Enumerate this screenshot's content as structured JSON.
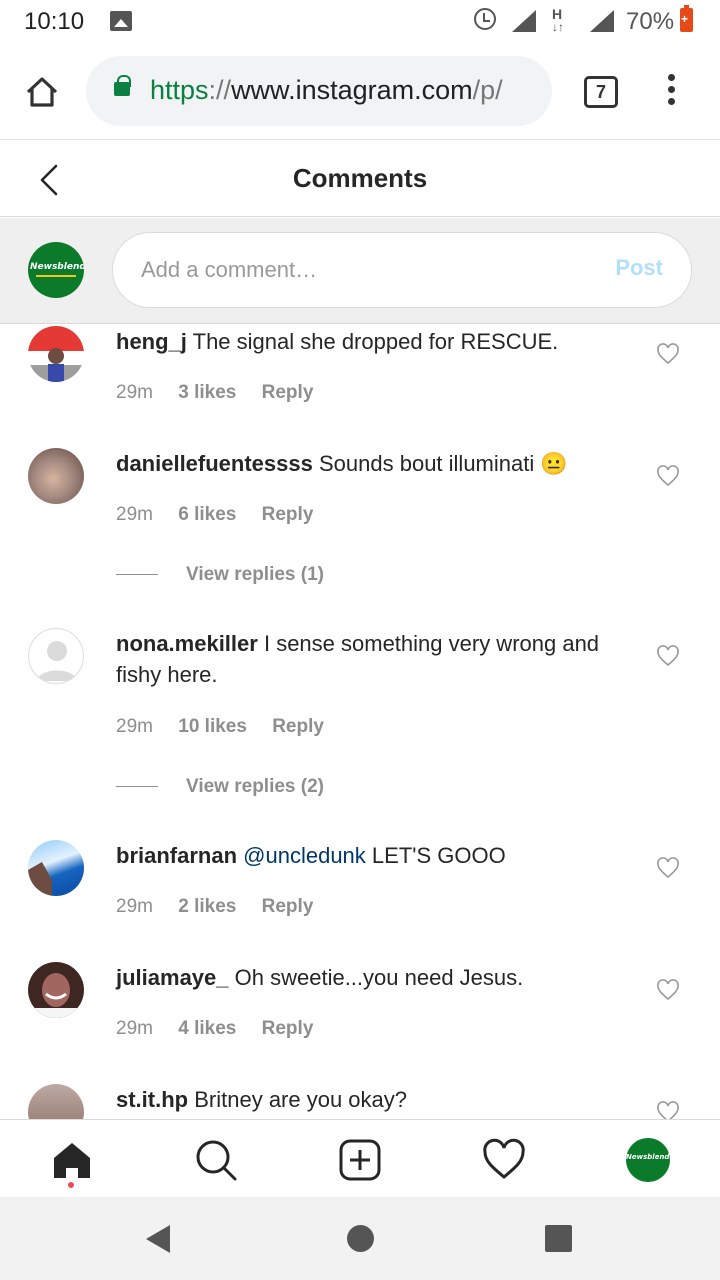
{
  "status_bar": {
    "time": "10:10",
    "network": "H",
    "battery": "70%"
  },
  "browser": {
    "url_scheme": "https",
    "url_sep": "://",
    "url_host": "www.instagram.com",
    "url_path": "/p/",
    "tab_count": "7"
  },
  "header": {
    "title": "Comments"
  },
  "composer": {
    "avatar_text": "Newsblenda",
    "placeholder": "Add a comment…",
    "post_label": "Post"
  },
  "comments": [
    {
      "user": "heng_j",
      "mention": "",
      "text": "The signal she dropped for RESCUE.",
      "time": "29m",
      "likes": "3 likes",
      "reply": "Reply",
      "view_replies": ""
    },
    {
      "user": "daniellefuentessss",
      "mention": "",
      "text": "Sounds bout illuminati 😐",
      "time": "29m",
      "likes": "6 likes",
      "reply": "Reply",
      "view_replies": "View replies (1)"
    },
    {
      "user": "nona.mekiller",
      "mention": "",
      "text": "I sense something very wrong and fishy here.",
      "time": "29m",
      "likes": "10 likes",
      "reply": "Reply",
      "view_replies": "View replies (2)"
    },
    {
      "user": "brianfarnan",
      "mention": "@uncledunk",
      "text": "LET'S GOOO",
      "time": "29m",
      "likes": "2 likes",
      "reply": "Reply",
      "view_replies": ""
    },
    {
      "user": "juliamaye_",
      "mention": "",
      "text": "Oh sweetie...you need Jesus.",
      "time": "29m",
      "likes": "4 likes",
      "reply": "Reply",
      "view_replies": ""
    },
    {
      "user": "st.it.hp",
      "mention": "",
      "text": "Britney are you okay?",
      "time": "",
      "likes": "",
      "reply": "",
      "view_replies": ""
    }
  ],
  "bottom_nav": {
    "avatar_text": "Newsblenda"
  },
  "colors": {
    "brand_green": "#0b7a2a",
    "link_blue": "#00376b",
    "post_disabled": "#b2dffc",
    "notification_red": "#ed4956"
  }
}
